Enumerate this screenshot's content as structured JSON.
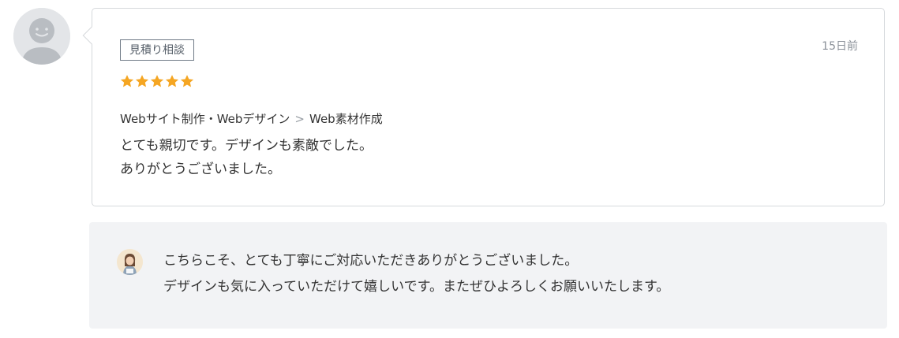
{
  "reviewer": {
    "avatar_icon": "default-user-icon"
  },
  "review": {
    "tag": "見積り相談",
    "date": "15日前",
    "rating": 5,
    "rating_max": 5,
    "star_color": "#f5a623",
    "category": {
      "parent": "Webサイト制作・Webデザイン",
      "separator": ">",
      "child": "Web素材作成"
    },
    "text_lines": [
      "とても親切です。デザインも素敵でした。",
      "ありがとうございました。"
    ]
  },
  "reply": {
    "avatar_icon": "seller-avatar-icon",
    "text_lines": [
      "こちらこそ、とても丁寧にご対応いただきありがとうございました。",
      "デザインも気に入っていただけて嬉しいです。またぜひよろしくお願いいたします。"
    ]
  }
}
